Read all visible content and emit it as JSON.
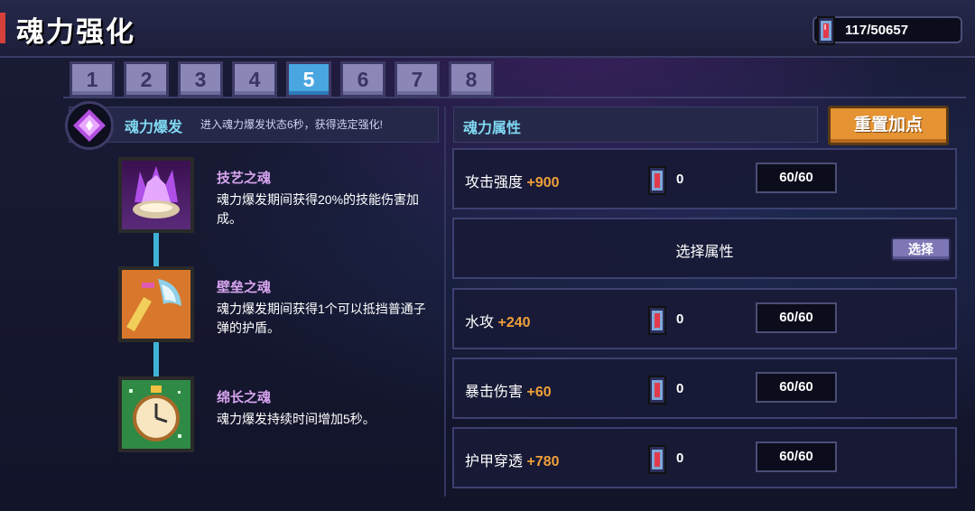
{
  "header": {
    "title": "魂力强化",
    "currency_value": "117/50657"
  },
  "tabs": [
    "1",
    "2",
    "3",
    "4",
    "5",
    "6",
    "7",
    "8"
  ],
  "active_tab": "5",
  "burst": {
    "name": "魂力爆发",
    "description": "进入魂力爆发状态6秒，获得选定强化!"
  },
  "souls": [
    {
      "name": "技艺之魂",
      "description": "魂力爆发期间获得20%的技能伤害加成。"
    },
    {
      "name": "壁垒之魂",
      "description": "魂力爆发期间获得1个可以抵挡普通子弹的护盾。"
    },
    {
      "name": "绵长之魂",
      "description": "魂力爆发持续时间增加5秒。"
    }
  ],
  "attributes": {
    "header": "魂力属性",
    "reset_label": "重置加点",
    "select_label": "选择属性",
    "select_button": "选择",
    "rows": [
      {
        "name": "攻击强度",
        "bonus": "+900",
        "count": "0",
        "cap": "60/60"
      },
      {
        "name": "水攻",
        "bonus": "+240",
        "count": "0",
        "cap": "60/60"
      },
      {
        "name": "暴击伤害",
        "bonus": "+60",
        "count": "0",
        "cap": "60/60"
      },
      {
        "name": "护甲穿透",
        "bonus": "+780",
        "count": "0",
        "cap": "60/60"
      }
    ]
  },
  "colors": {
    "accent_blue": "#4aa6e0",
    "bonus_orange": "#f0a03a",
    "reset_orange": "#e59333",
    "soul_name_purple": "#d7a4ef",
    "header_cyan": "#7fd9f0"
  },
  "icons": {
    "currency": "soul-gem-icon",
    "burst": "soul-burst-icon",
    "souls": [
      "skill-soul-icon",
      "barrier-soul-icon",
      "duration-soul-icon"
    ]
  }
}
